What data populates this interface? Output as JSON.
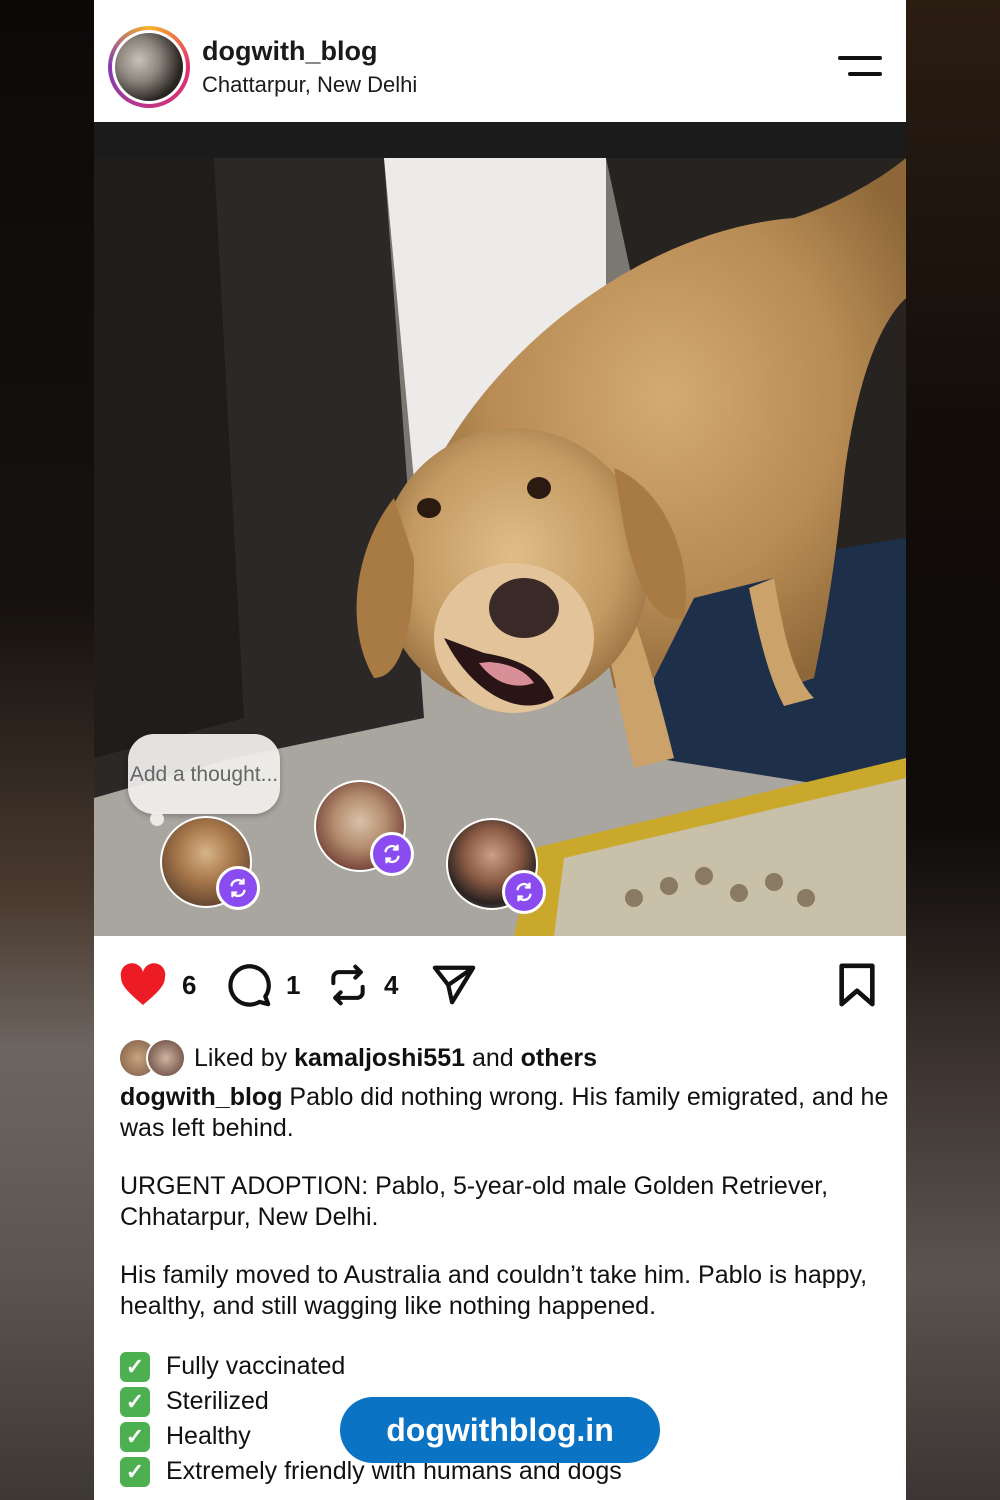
{
  "post": {
    "username": "dogwith_blog",
    "location": "Chattarpur, New Delhi"
  },
  "overlay": {
    "thought_placeholder": "Add a thought..."
  },
  "actions": {
    "likes": "6",
    "comments": "1",
    "reposts": "4"
  },
  "likes_row": {
    "prefix": "Liked by ",
    "user": "kamaljoshi551",
    "middle": " and ",
    "others": "others"
  },
  "caption": {
    "author": "dogwith_blog",
    "line1": " Pablo did nothing wrong. His family emigrated, and he was left behind.",
    "para2": "URGENT ADOPTION: Pablo, 5-year-old male Golden Retriever, Chhatarpur, New Delhi.",
    "para3": "His family moved to Australia and couldn’t take him. Pablo is happy, healthy, and still wagging like nothing happened.",
    "checklist": [
      "Fully vaccinated",
      "Sterilized",
      "Healthy",
      "Extremely friendly with humans and dogs"
    ]
  },
  "watermark": "dogwithblog.in",
  "icons": {
    "like": "heart-icon",
    "comment": "comment-icon",
    "repost": "repost-icon",
    "share": "send-icon",
    "save": "bookmark-icon",
    "menu": "menu-icon"
  },
  "colors": {
    "like": "#ed1c24",
    "repost_badge": "#8a4cf0",
    "watermark_bg": "#0b73c3",
    "check": "#4caf50"
  }
}
